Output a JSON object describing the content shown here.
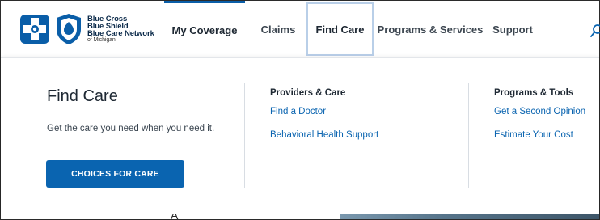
{
  "brand": {
    "line1": "Blue Cross",
    "line2": "Blue Shield",
    "line3": "Blue Care Network",
    "line4": "of Michigan"
  },
  "nav": {
    "items": [
      {
        "label": "My Coverage"
      },
      {
        "label": "Claims"
      },
      {
        "label": "Find Care"
      },
      {
        "label": "Programs & Services"
      },
      {
        "label": "Support"
      }
    ]
  },
  "panel": {
    "title": "Find Care",
    "description": "Get the care you need when you need it.",
    "cta_label": "CHOICES FOR CARE",
    "providers": {
      "heading": "Providers & Care",
      "links": [
        "Find a Doctor",
        "Behavioral Health Support"
      ]
    },
    "tools": {
      "heading": "Programs & Tools",
      "links": [
        "Get a Second Opinion",
        "Estimate Your Cost"
      ]
    }
  },
  "background": {
    "partial_text": "A"
  },
  "colors": {
    "brand_blue": "#0a64b0",
    "active_border": "#0a5ea8",
    "selected_border": "#b9cfe8"
  }
}
